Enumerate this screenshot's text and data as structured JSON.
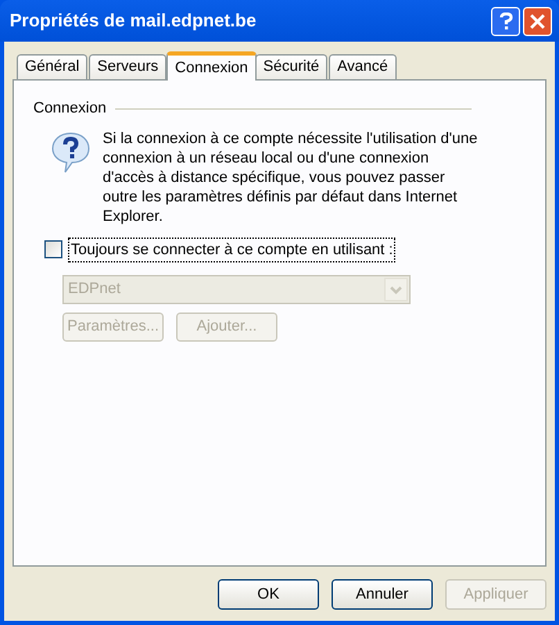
{
  "window": {
    "title": "Propriétés de mail.edpnet.be"
  },
  "tabs": [
    {
      "label": "Général",
      "selected": false
    },
    {
      "label": "Serveurs",
      "selected": false
    },
    {
      "label": "Connexion",
      "selected": true
    },
    {
      "label": "Sécurité",
      "selected": false
    },
    {
      "label": "Avancé",
      "selected": false
    }
  ],
  "group": {
    "title": "Connexion",
    "info_text": "Si la connexion à ce compte nécessite l'utilisation d'une connexion à un réseau local ou d'une connexion d'accès à distance spécifique, vous pouvez passer outre les paramètres définis par défaut dans Internet Explorer.",
    "checkbox": {
      "label": "Toujours se connecter à ce compte en utilisant :",
      "checked": false
    },
    "dropdown": {
      "value": "EDPnet",
      "disabled": true
    },
    "buttons": [
      {
        "label": "Paramètres...",
        "disabled": true
      },
      {
        "label": "Ajouter...",
        "disabled": true
      }
    ]
  },
  "footer_buttons": [
    {
      "label": "OK",
      "disabled": false
    },
    {
      "label": "Annuler",
      "disabled": false
    },
    {
      "label": "Appliquer",
      "disabled": true
    }
  ]
}
